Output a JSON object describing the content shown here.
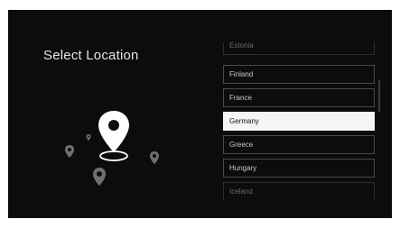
{
  "screen": {
    "title": "Select Location"
  },
  "locations": {
    "items": [
      {
        "label": "Estonia",
        "state": "faded"
      },
      {
        "label": "Finland",
        "state": "normal"
      },
      {
        "label": "France",
        "state": "normal"
      },
      {
        "label": "Germany",
        "state": "selected"
      },
      {
        "label": "Greece",
        "state": "normal"
      },
      {
        "label": "Hungary",
        "state": "normal"
      },
      {
        "label": "Iceland",
        "state": "faded"
      }
    ]
  },
  "colors": {
    "background": "#0c0c0d",
    "selected_bg": "#f5f5f5",
    "pin_main": "#ffffff",
    "pin_secondary": "#6e6e74"
  },
  "icons": [
    "location-pin-icon"
  ]
}
